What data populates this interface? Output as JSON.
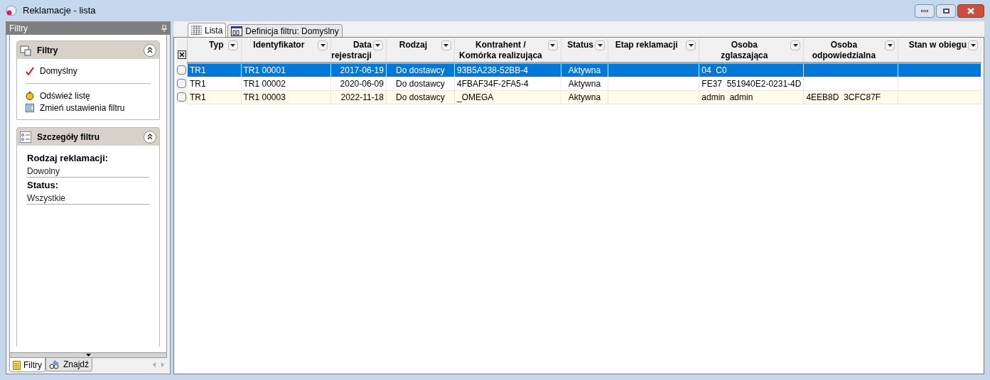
{
  "window": {
    "title": "Reklamacje - lista"
  },
  "side_panel": {
    "title": "Filtry",
    "filters_group": {
      "title": "Filtry",
      "expanded": true,
      "filters": [
        "Domyślny"
      ],
      "actions": [
        {
          "kind": "refresh",
          "label": "Odśwież listę"
        },
        {
          "kind": "settings",
          "label": "Zmień ustawienia filtru"
        }
      ]
    },
    "details_group": {
      "title": "Szczegóły filtru",
      "expanded": true,
      "fields": [
        {
          "label": "Rodzaj reklamacji:",
          "value": "Dowolny"
        },
        {
          "label": "Status:",
          "value": "Wszystkie"
        }
      ]
    },
    "bottom_tabs": [
      {
        "kind": "filters",
        "label": "Filtry",
        "selected": true
      },
      {
        "kind": "find",
        "label": "Znajdź",
        "selected": false
      }
    ]
  },
  "tabs": [
    {
      "kind": "list",
      "label": "Lista",
      "selected": true
    },
    {
      "kind": "definition",
      "label": "Definicja filtru: Domyślny",
      "selected": false
    }
  ],
  "table": {
    "columns": [
      "Typ",
      "Identyfikator",
      "Data\nrejestracji",
      "Rodzaj",
      "Kontrahent /\nKomórka realizująca",
      "Status",
      "Etap reklamacji",
      "Osoba\nzglaszająca",
      "Osoba\nodpowiedzialna",
      "Stan w obiegu"
    ],
    "rows": [
      {
        "selected": true,
        "checked": false,
        "cells": [
          "TR1",
          "TR1 00001",
          "2017-06-19",
          "Do dostawcy",
          "93B5A238-52BB-4",
          "Aktywna",
          null,
          "04  C0",
          null,
          null
        ]
      },
      {
        "selected": false,
        "checked": false,
        "cells": [
          "TR1",
          "TR1 00002",
          "2020-06-09",
          "Do dostawcy",
          "4FBAF34F-2FA5-4",
          "Aktywna",
          null,
          "FE37  551940E2-0231-4D",
          null,
          null
        ]
      },
      {
        "selected": false,
        "checked": false,
        "cells": [
          "TR1",
          "TR1 00003",
          "2022-11-18",
          "Do dostawcy",
          "_OMEGA",
          "Aktywna",
          null,
          "admin  admin",
          "4EEB8D  3CFC87F",
          null
        ]
      }
    ]
  }
}
